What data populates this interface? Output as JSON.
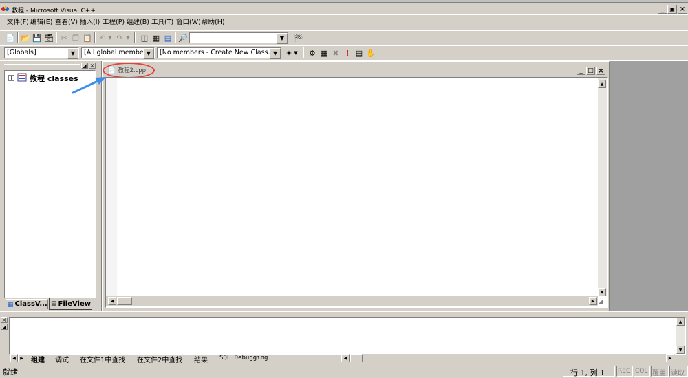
{
  "window": {
    "title": "教程 - Microsoft Visual C++"
  },
  "menu": {
    "items": [
      "文件(F)",
      "编辑(E)",
      "查看(V)",
      "插入(I)",
      "工程(P)",
      "组建(B)",
      "工具(T)",
      "窗口(W)",
      "帮助(H)"
    ]
  },
  "wizardbar": {
    "scope": "[Globals]",
    "filter": "[All global members",
    "members": "[No members - Create New Class..."
  },
  "workspace": {
    "tree_root": "教程 classes",
    "tab_classview": "ClassV...",
    "tab_fileview": "FileView"
  },
  "editor": {
    "doc_tab": "教程2.cpp"
  },
  "output": {
    "tabs": [
      "组建",
      "调试",
      "在文件1中查找",
      "在文件2中查找",
      "结果",
      "SQL Debugging"
    ]
  },
  "status": {
    "ready": "就绪",
    "position": "行 1, 列 1",
    "rec": "REC",
    "col": "COL",
    "ovr": "覆盖",
    "read": "读取"
  },
  "colors": {
    "face": "#d4d0c8",
    "appspace": "#a0a0a0",
    "annotation_red": "#e8403a",
    "annotation_blue": "#3c8ee8"
  },
  "icons": [
    "vc-logo-icon",
    "new-file-icon",
    "open-icon",
    "save-icon",
    "save-all-icon",
    "cut-icon",
    "copy-icon",
    "paste-icon",
    "undo-icon",
    "redo-icon",
    "workspace-icon",
    "output-icon",
    "window-list-icon",
    "find-in-files-icon",
    "find-icon",
    "compile-icon",
    "build-icon",
    "stop-build-icon",
    "execute-icon",
    "go-icon",
    "breakpoint-icon",
    "wizard-icon"
  ]
}
